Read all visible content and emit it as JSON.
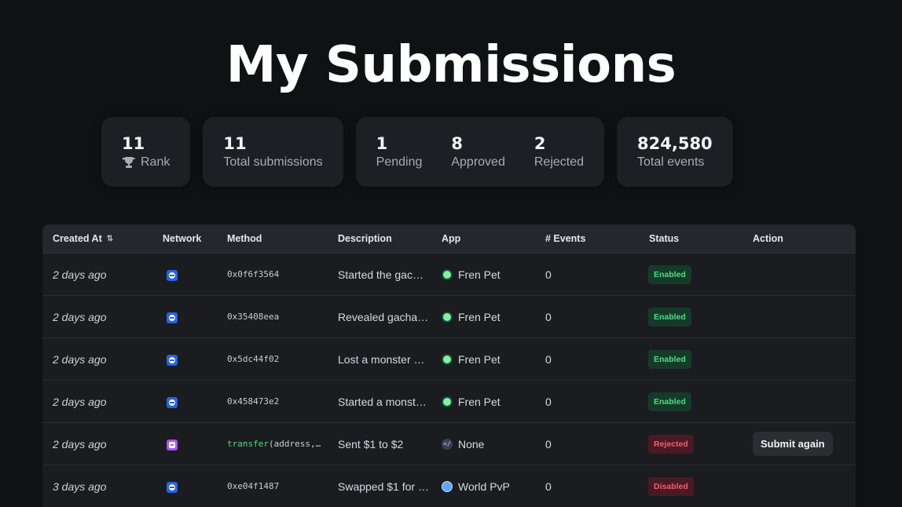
{
  "page": {
    "title": "My Submissions"
  },
  "stats": {
    "rank": {
      "value": "11",
      "label": "Rank"
    },
    "total": {
      "value": "11",
      "label": "Total submissions"
    },
    "pending": {
      "value": "1",
      "label": "Pending"
    },
    "approved": {
      "value": "8",
      "label": "Approved"
    },
    "rejected": {
      "value": "2",
      "label": "Rejected"
    },
    "events": {
      "value": "824,580",
      "label": "Total events"
    }
  },
  "table": {
    "headers": {
      "created_at": "Created At",
      "network": "Network",
      "method": "Method",
      "description": "Description",
      "app": "App",
      "events": "# Events",
      "status": "Status",
      "action": "Action"
    },
    "rows": [
      {
        "created": "2 days ago",
        "network": "blue",
        "method_fn": "",
        "method_rest": "0x0f6f3564",
        "description": "Started the gac…",
        "app_icon": "fren-pet-icon",
        "app": "Fren Pet",
        "events": "0",
        "status": "Enabled",
        "action": ""
      },
      {
        "created": "2 days ago",
        "network": "blue",
        "method_fn": "",
        "method_rest": "0x35408eea",
        "description": "Revealed gacha …",
        "app_icon": "fren-pet-icon",
        "app": "Fren Pet",
        "events": "0",
        "status": "Enabled",
        "action": ""
      },
      {
        "created": "2 days ago",
        "network": "blue",
        "method_fn": "",
        "method_rest": "0x5dc44f02",
        "description": "Lost a monster …",
        "app_icon": "fren-pet-icon",
        "app": "Fren Pet",
        "events": "0",
        "status": "Enabled",
        "action": ""
      },
      {
        "created": "2 days ago",
        "network": "blue",
        "method_fn": "",
        "method_rest": "0x458473e2",
        "description": "Started a monst…",
        "app_icon": "fren-pet-icon",
        "app": "Fren Pet",
        "events": "0",
        "status": "Enabled",
        "action": ""
      },
      {
        "created": "2 days ago",
        "network": "purple",
        "method_fn": "transfer",
        "method_rest": "(address,…",
        "description": "Sent $1 to $2",
        "app_icon": "code-icon",
        "app": "None",
        "events": "0",
        "status": "Rejected",
        "action": "Submit again"
      },
      {
        "created": "3 days ago",
        "network": "blue",
        "method_fn": "",
        "method_rest": "0xe04f1487",
        "description": "Swapped $1 for …",
        "app_icon": "globe-icon",
        "app": "World PvP",
        "events": "0",
        "status": "Disabled",
        "action": ""
      }
    ]
  },
  "colors": {
    "enabled": "#4ade80",
    "rejected": "#f25c72",
    "network_blue": "#2563eb",
    "network_purple": "#a855f7"
  }
}
